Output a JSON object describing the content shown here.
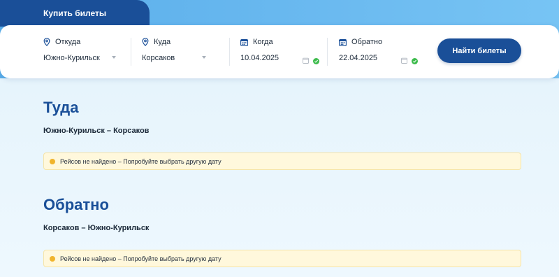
{
  "header": {
    "buy_tab_label": "Купить билеты"
  },
  "search": {
    "from": {
      "label": "Откуда",
      "value": "Южно-Курильск",
      "icon": "map-pin-icon"
    },
    "to": {
      "label": "Куда",
      "value": "Корсаков",
      "icon": "map-pin-icon"
    },
    "when": {
      "label": "Когда",
      "value": "10.04.2025",
      "icon": "calendar-icon"
    },
    "return": {
      "label": "Обратно",
      "value": "22.04.2025",
      "icon": "calendar-icon"
    },
    "find_button_label": "Найти билеты"
  },
  "outbound": {
    "title": "Туда",
    "route": "Южно-Курильск – Корсаков",
    "notice": "Рейсов не найдено – Попробуйте выбрать другую дату"
  },
  "inbound": {
    "title": "Обратно",
    "route": "Корсаков – Южно-Курильск",
    "notice": "Рейсов не найдено – Попробуйте выбрать другую дату"
  },
  "colors": {
    "brand": "#1a4f98",
    "header_gradient": "#5aaeea",
    "notice_bg": "#fff8dc",
    "notice_dot": "#f0b42c",
    "check": "#3dbb4c"
  }
}
